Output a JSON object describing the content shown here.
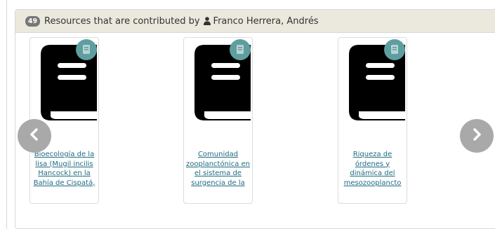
{
  "header": {
    "count": "49",
    "prefix": "Resources that are contributed by",
    "contributor": "Franco Herrera, Andrés"
  },
  "cards": [
    {
      "title": "Bioecología de la lisa (Mugil incilis Hancock) en la Bahía de Cispatá,"
    },
    {
      "title": "Comunidad zooplanctónica en el sistema de surgencia de la"
    },
    {
      "title": "Riqueza de órdenes y dinámica del mesozooplancto"
    }
  ],
  "icons": {
    "book": "book-icon",
    "type_badge": "document-type-icon",
    "user": "user-icon",
    "prev": "chevron-left-icon",
    "next": "chevron-right-icon"
  },
  "colors": {
    "header_bg": "#ebe8dd",
    "badge_bg": "#777777",
    "link": "#1e6b82",
    "type_badge": "#5f9ea0",
    "nav_btn": "#a9a9a9"
  }
}
